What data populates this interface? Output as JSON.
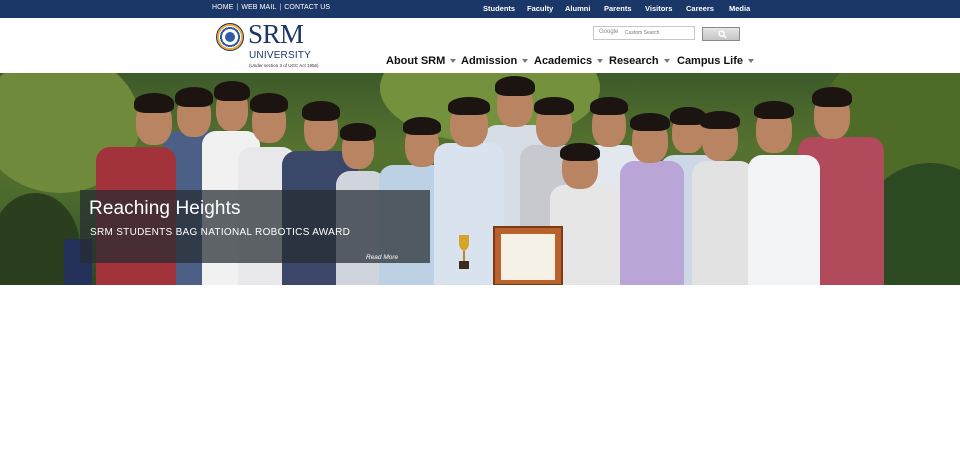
{
  "topbar": {
    "left_links": [
      "HOME",
      "WEB MAIL",
      "CONTACT US"
    ],
    "separator": "|",
    "right_links": [
      "Students",
      "Faculty",
      "Alumni",
      "Parents",
      "Visitors",
      "Careers",
      "Media"
    ],
    "background": "#1b3768"
  },
  "logo": {
    "name": "SRM",
    "subtitle": "UNIVERSITY",
    "tagline": "(Under section 3 of UGC Act 1956)",
    "color": "#1b3768"
  },
  "search": {
    "brand": "Google",
    "placeholder": "Custom Search",
    "button_icon": "search-icon"
  },
  "nav": {
    "items": [
      "About SRM",
      "Admission",
      "Academics",
      "Research",
      "Campus Life"
    ],
    "dropdown_icon": "caret-down-icon"
  },
  "banner": {
    "title": "Reaching Heights",
    "subtitle": "SRM STUDENTS BAG NATIONAL ROBOTICS AWARD",
    "read_more": "Read More"
  }
}
